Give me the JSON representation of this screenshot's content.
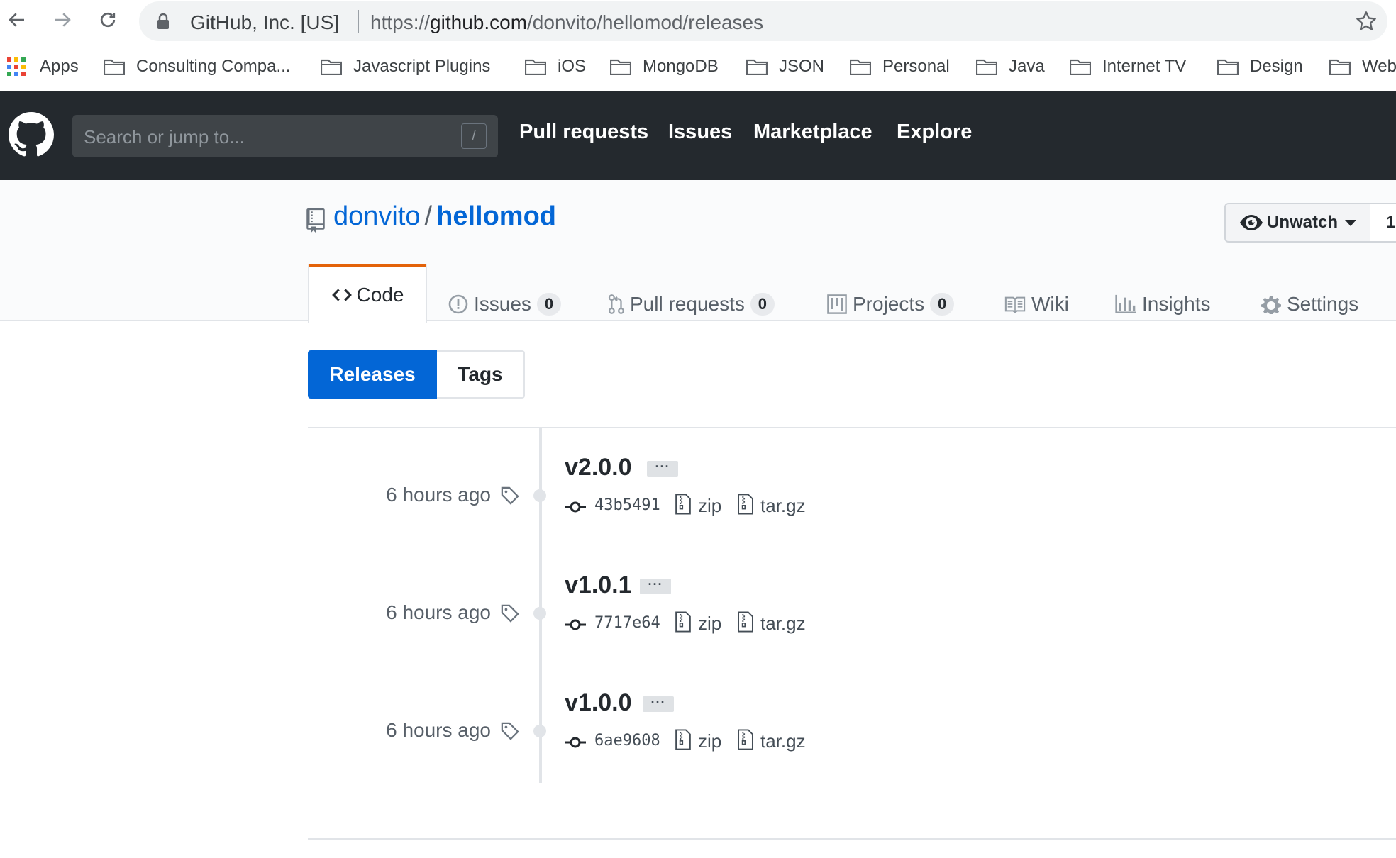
{
  "browser": {
    "site_identity": "GitHub, Inc. [US]",
    "url_scheme": "https://",
    "url_domain": "github.com",
    "url_path": "/donvito/hellomod/releases"
  },
  "bookmarks": {
    "apps_label": "Apps",
    "items": [
      "Consulting Compa...",
      "Javascript Plugins",
      "iOS",
      "MongoDB",
      "JSON",
      "Personal",
      "Java",
      "Internet TV",
      "Design",
      "Web"
    ]
  },
  "github_header": {
    "search_placeholder": "Search or jump to...",
    "search_shortcut": "/",
    "nav": [
      "Pull requests",
      "Issues",
      "Marketplace",
      "Explore"
    ]
  },
  "repo": {
    "owner": "donvito",
    "separator": "/",
    "name": "hellomod",
    "watch_label": "Unwatch",
    "watch_count": "1"
  },
  "tabs": {
    "code": "Code",
    "issues": "Issues",
    "issues_count": "0",
    "pulls": "Pull requests",
    "pulls_count": "0",
    "projects": "Projects",
    "projects_count": "0",
    "wiki": "Wiki",
    "insights": "Insights",
    "settings": "Settings"
  },
  "switcher": {
    "releases": "Releases",
    "tags": "Tags",
    "active": "Releases"
  },
  "releases": [
    {
      "date": "6 hours ago",
      "version": "v2.0.0",
      "more": "···",
      "commit": "43b5491",
      "zip": "zip",
      "targz": "tar.gz"
    },
    {
      "date": "6 hours ago",
      "version": "v1.0.1",
      "more": "···",
      "commit": "7717e64",
      "zip": "zip",
      "targz": "tar.gz"
    },
    {
      "date": "6 hours ago",
      "version": "v1.0.0",
      "more": "···",
      "commit": "6ae9608",
      "zip": "zip",
      "targz": "tar.gz"
    }
  ],
  "colors": {
    "header_bg": "#24292e",
    "link_blue": "#0366d6",
    "active_tab_accent": "#e36209",
    "muted_text": "#586069"
  }
}
